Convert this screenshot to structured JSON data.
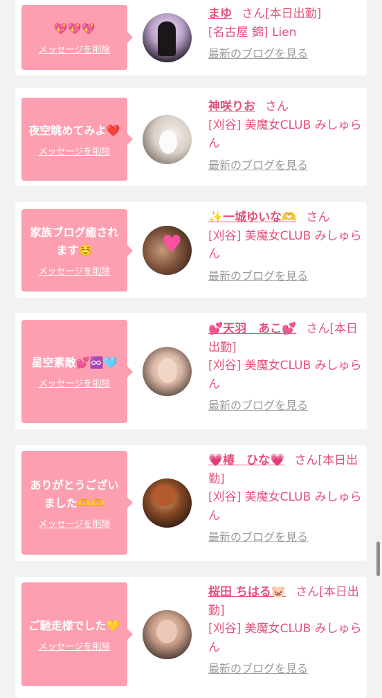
{
  "messages": [
    {
      "message": "💖💖💖",
      "delete_label": "メッセージを削除",
      "name": "まゆ",
      "san": "さん",
      "status": "[本日出勤]",
      "shop": "[名古屋 錦] Lien",
      "blog_label": "最新のブログを見る",
      "avatar_icon": "avatar-photo"
    },
    {
      "message": "夜空眺めてみよ❤️",
      "delete_label": "メッセージを削除",
      "name": "神咲りお",
      "san": "さん",
      "status": "",
      "shop": "[刈谷] 美魔女CLUB みしゅらん",
      "blog_label": "最新のブログを見る",
      "avatar_icon": "avatar-photo"
    },
    {
      "message": "家族ブログ癒されます☺️",
      "delete_label": "メッセージを削除",
      "name": "✨一城ゆいな🫶",
      "san": "さん",
      "status": "",
      "shop": "[刈谷] 美魔女CLUB みしゅらん",
      "blog_label": "最新のブログを見る",
      "avatar_icon": "avatar-photo"
    },
    {
      "message": "星空素敵💕♾️🩵",
      "delete_label": "メッセージを削除",
      "name": "💕天羽　あこ💕",
      "san": "さん",
      "status": "[本日出勤]",
      "shop": "[刈谷] 美魔女CLUB みしゅらん",
      "blog_label": "最新のブログを見る",
      "avatar_icon": "avatar-photo"
    },
    {
      "message": "ありがとうございました🫶🫶",
      "delete_label": "メッセージを削除",
      "name": "💗椿　ひな💗",
      "san": "さん",
      "status": "[本日出勤]",
      "shop": "[刈谷] 美魔女CLUB みしゅらん",
      "blog_label": "最新のブログを見る",
      "avatar_icon": "avatar-photo"
    },
    {
      "message": "ご馳走様でした💛",
      "delete_label": "メッセージを削除",
      "name": "桜田 ちはる🐷",
      "san": "さん",
      "status": "[本日出勤]",
      "shop": "[刈谷] 美魔女CLUB みしゅらん",
      "blog_label": "最新のブログを見る",
      "avatar_icon": "avatar-photo"
    }
  ],
  "colors": {
    "background": "#f2f2f2",
    "bubble": "#fd9fb0",
    "accent": "#e4517a",
    "link_gray": "#9b9b9b"
  }
}
